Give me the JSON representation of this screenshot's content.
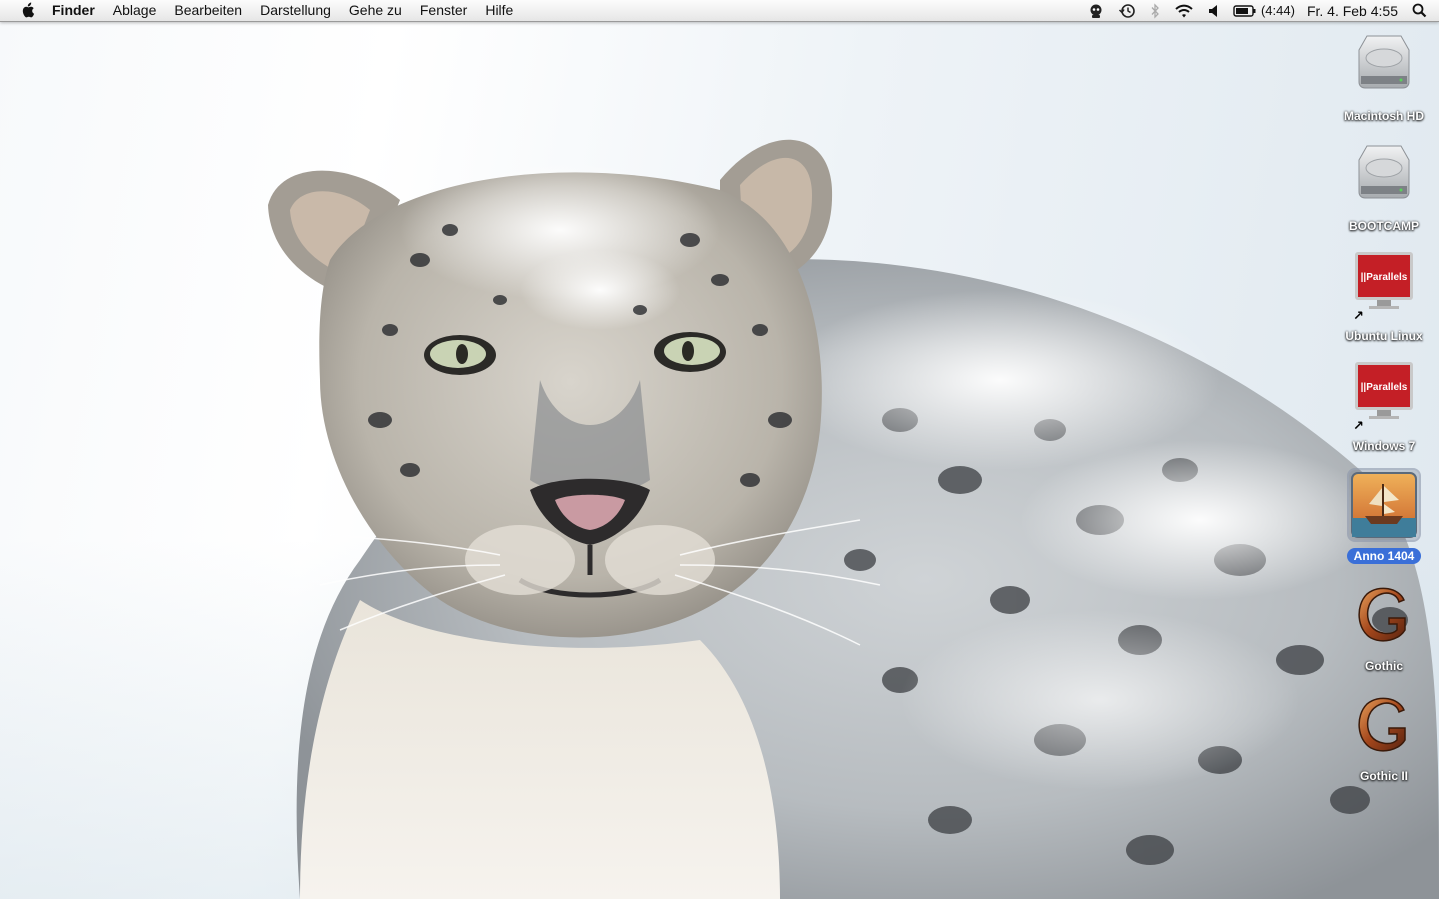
{
  "menubar": {
    "apple_icon": "apple-logo-icon",
    "app_name": "Finder",
    "items": [
      "Ablage",
      "Bearbeiten",
      "Darstellung",
      "Gehe zu",
      "Fenster",
      "Hilfe"
    ],
    "status": {
      "battery_time": "(4:44)",
      "clock": "Fr. 4. Feb  4:55",
      "icons": [
        "user-agent-icon",
        "time-machine-icon",
        "bluetooth-icon",
        "wifi-icon",
        "volume-icon",
        "battery-icon",
        "spotlight-icon"
      ]
    }
  },
  "desktop": {
    "icons": [
      {
        "label": "Macintosh HD",
        "icon": "hard-drive-icon",
        "selected": false
      },
      {
        "label": "BOOTCAMP",
        "icon": "hard-drive-icon",
        "selected": false
      },
      {
        "label": "Ubuntu Linux",
        "icon": "parallels-vm-icon",
        "selected": false
      },
      {
        "label": "Windows 7",
        "icon": "parallels-vm-icon",
        "selected": false
      },
      {
        "label": "Anno 1404",
        "icon": "anno-ship-icon",
        "selected": true
      },
      {
        "label": "Gothic",
        "icon": "gothic-g-icon",
        "selected": false
      },
      {
        "label": "Gothic II",
        "icon": "gothic-g-icon",
        "selected": false
      }
    ],
    "parallels_brand": "||Parallels",
    "selection_color": "#3a6fd8"
  }
}
